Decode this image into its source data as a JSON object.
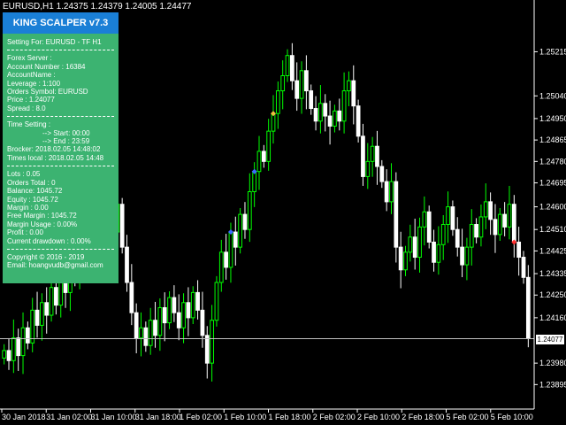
{
  "window": {
    "title": "EURUSD,H1  1.24375 1.24379 1.24005 1.24477"
  },
  "panel": {
    "header": "KING SCALPER v7.3",
    "setting_for": "Setting For: EURUSD - TF H1",
    "forex_server": "Forex Server :",
    "account_number": "Account Number : 16384",
    "account_name": "AccountName :",
    "leverage": "Leverage : 1:100",
    "orders_symbol": "Orders Symbol: EURUSD",
    "price": "Price : 1.24077",
    "spread": "Spread : 8.0",
    "time_setting": "Time Setting :",
    "start": "--> Start: 00:00",
    "end": "--> End : 23:59",
    "broker": "Brocker: 2018.02.05 14:48:02",
    "times_local": "Times local : 2018.02.05 14:48",
    "lots": "Lots      : 0.05",
    "orders_total": "Orders Total : 0",
    "balance": "Balance: 1045.72",
    "equity": "Equity   : 1045.72",
    "margin": "Margin : 0.00",
    "free_margin": "Free Margin : 1045.72",
    "margin_usage": "Margin Usage : 0.00%",
    "profit": "Profit : 0.00",
    "drawdown": "Current drawdown : 0.00%",
    "copyright": "Copyright © 2016 - 2019",
    "email": "Email: hoangvudb@gmail.com"
  },
  "current_price_tag": "1.24077",
  "chart_data": {
    "type": "candlestick",
    "y_ticks": [
      "1.25215",
      "1.25040",
      "1.24950",
      "1.24865",
      "1.24780",
      "1.24695",
      "1.24600",
      "1.24510",
      "1.24425",
      "1.24335",
      "1.24250",
      "1.24160",
      "1.24077",
      "1.23980",
      "1.23895"
    ],
    "y_tick_values": [
      1.25215,
      1.2504,
      1.2495,
      1.24865,
      1.2478,
      1.24695,
      1.246,
      1.2451,
      1.24425,
      1.24335,
      1.2425,
      1.2416,
      1.24077,
      1.2398,
      1.23895
    ],
    "x_ticks": [
      "30 Jan 2018",
      "31 Jan 02:00",
      "31 Jan 10:00",
      "31 Jan 18:00",
      "1 Feb 02:00",
      "1 Feb 10:00",
      "1 Feb 18:00",
      "2 Feb 02:00",
      "2 Feb 10:00",
      "2 Feb 18:00",
      "5 Feb 02:00",
      "5 Feb 10:00"
    ],
    "ylim": [
      1.2384,
      1.2535
    ],
    "current_price": 1.24077,
    "colors": {
      "bull": "#00ff00",
      "bear": "#ffffff",
      "background": "#000000",
      "price_line": "#c0c0c0"
    },
    "closes": [
      1.2403,
      1.2399,
      1.2408,
      1.2401,
      1.2412,
      1.2406,
      1.2419,
      1.2413,
      1.2422,
      1.2417,
      1.2428,
      1.2421,
      1.2433,
      1.2426,
      1.2438,
      1.2431,
      1.2442,
      1.2436,
      1.2447,
      1.2441,
      1.2452,
      1.2446,
      1.2457,
      1.245,
      1.2461,
      1.2444,
      1.243,
      1.2418,
      1.2408,
      1.2412,
      1.2405,
      1.2415,
      1.2409,
      1.242,
      1.2414,
      1.2424,
      1.2418,
      1.2412,
      1.2422,
      1.2416,
      1.2426,
      1.2419,
      1.2409,
      1.2398,
      1.2415,
      1.243,
      1.2442,
      1.2436,
      1.245,
      1.2444,
      1.2457,
      1.2451,
      1.2466,
      1.2474,
      1.2482,
      1.2478,
      1.249,
      1.2497,
      1.2506,
      1.2512,
      1.252,
      1.251,
      1.2503,
      1.2514,
      1.2506,
      1.2499,
      1.2494,
      1.2501,
      1.2496,
      1.2492,
      1.2498,
      1.2494,
      1.2506,
      1.251,
      1.25,
      1.2488,
      1.2472,
      1.2478,
      1.2484,
      1.2476,
      1.247,
      1.2462,
      1.247,
      1.2444,
      1.2435,
      1.2442,
      1.2448,
      1.244,
      1.2452,
      1.2458,
      1.2446,
      1.2438,
      1.2445,
      1.2453,
      1.246,
      1.2451,
      1.2444,
      1.2437,
      1.2444,
      1.2453,
      1.2448,
      1.2456,
      1.2462,
      1.2455,
      1.2449,
      1.2457,
      1.2452,
      1.2461,
      1.2446,
      1.244,
      1.2432,
      1.2408
    ]
  }
}
